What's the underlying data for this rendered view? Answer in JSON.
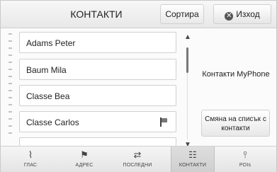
{
  "header": {
    "title": "КОНТАКТИ",
    "sort_label": "Сортира",
    "exit_label": "Изход"
  },
  "contacts": [
    {
      "name": "Adams Peter"
    },
    {
      "name": "Baum Mila"
    },
    {
      "name": "Classe Bea"
    },
    {
      "name": "Classe Carlos",
      "flag_icon": "flag-icon"
    }
  ],
  "side": {
    "source_label": "Контакти MyPhone",
    "change_button": "Смяна на списък с контакти"
  },
  "tabs": [
    {
      "label": "ГЛАС",
      "icon": "voice-dial-icon"
    },
    {
      "label": "АДРЕС",
      "icon": "flag-icon"
    },
    {
      "label": "ПОСЛЕДНИ",
      "icon": "recent-destinations-icon"
    },
    {
      "label": "КОНТАКТИ",
      "icon": "contacts-icon",
      "active": true
    },
    {
      "label": "POIs",
      "icon": "poi-icon"
    }
  ]
}
